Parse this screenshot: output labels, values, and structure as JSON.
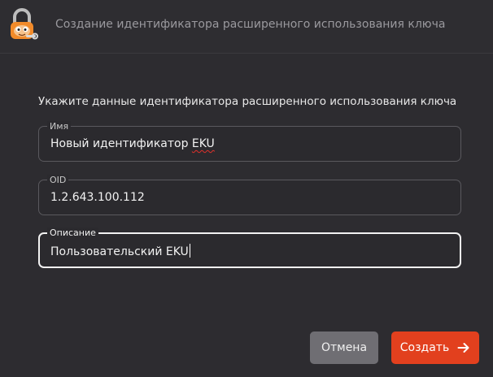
{
  "window": {
    "title": "Создание идентификатора расширенного использования ключа"
  },
  "form": {
    "instruction": "Укажите данные идентификатора расширенного использования ключа",
    "name": {
      "label": "Имя",
      "value_main": "Новый идентификатор ",
      "value_flagged": "EKU"
    },
    "oid": {
      "label": "OID",
      "value": "1.2.643.100.112"
    },
    "description": {
      "label": "Описание",
      "value": "Пользовательский EKU"
    }
  },
  "buttons": {
    "cancel_label": "Отмена",
    "create_label": "Создать"
  },
  "icons": {
    "app": "padlock-mascot-icon",
    "create": "arrow-right-icon"
  },
  "colors": {
    "accent": "#e2401e",
    "cancel_button": "#6f6e73",
    "background": "#2d2c30"
  }
}
